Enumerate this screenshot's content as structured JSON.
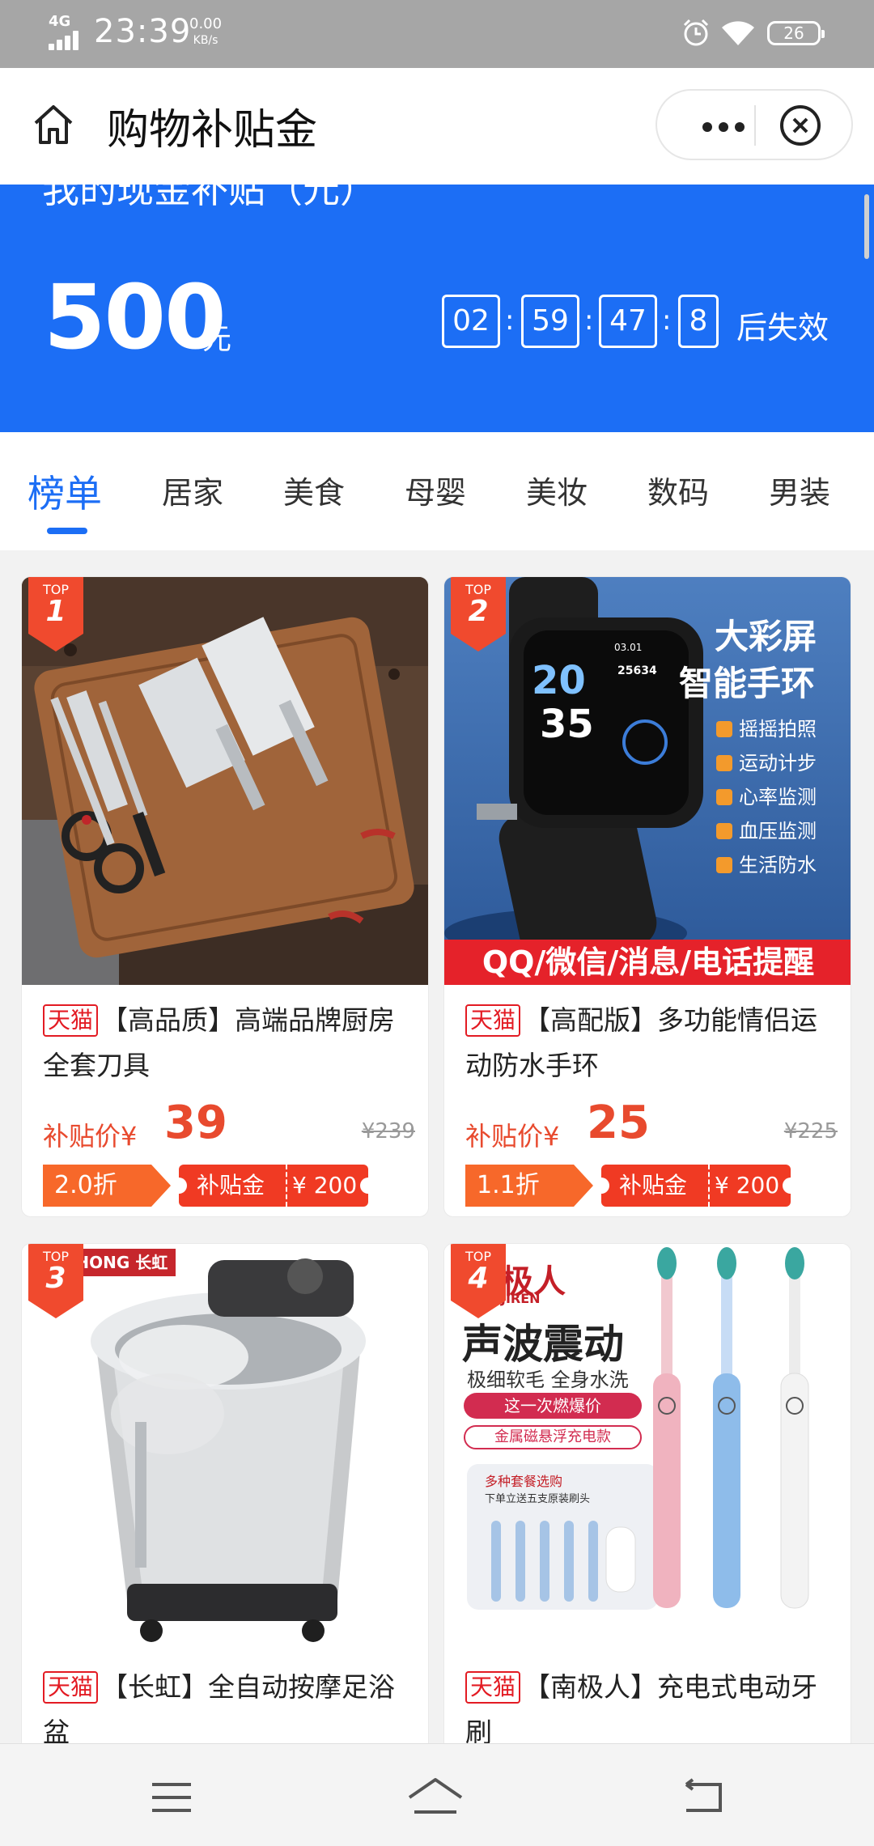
{
  "status_bar": {
    "network": "4G",
    "time": "23:39",
    "speed_value": "0.00",
    "speed_unit": "KB/s",
    "battery": "26"
  },
  "header": {
    "title": "购物补贴金"
  },
  "banner": {
    "cut_text": "我的现金补贴（元）",
    "amount": "500",
    "unit": "元",
    "countdown": [
      "02",
      "59",
      "47",
      "8"
    ],
    "separator": ":",
    "expire_text": "后失效"
  },
  "tabs": [
    "榜单",
    "居家",
    "美食",
    "母婴",
    "美妆",
    "数码",
    "男装"
  ],
  "products": [
    {
      "rank_label": "TOP",
      "rank": "1",
      "shop": "天猫",
      "name": "【高品质】高端品牌厨房全套刀具",
      "price_label": "补贴价¥",
      "price": "39",
      "original_price": "¥239",
      "discount": "2.0折",
      "coupon_label": "补贴金",
      "coupon_value": "¥ 200"
    },
    {
      "rank_label": "TOP",
      "rank": "2",
      "shop": "天猫",
      "name": "【高配版】多功能情侣运动防水手环",
      "price_label": "补贴价¥",
      "price": "25",
      "original_price": "¥225",
      "discount": "1.1折",
      "coupon_label": "补贴金",
      "coupon_value": "¥ 200",
      "image_text": {
        "headline1": "大彩屏",
        "headline2": "智能手环",
        "features": [
          "摇摇拍照",
          "运动计步",
          "心率监测",
          "血压监测",
          "生活防水"
        ],
        "bottom": "QQ/微信/消息/电话提醒",
        "watch_time_h": "20",
        "watch_time_m": "35",
        "watch_date": "03.01",
        "watch_steps": "25634"
      }
    },
    {
      "rank_label": "TOP",
      "rank": "3",
      "shop": "天猫",
      "name": "【长虹】全自动按摩足浴盆",
      "image_text": {
        "brand": "GHONG 长虹"
      }
    },
    {
      "rank_label": "TOP",
      "rank": "4",
      "shop": "天猫",
      "name": "【南极人】充电式电动牙刷",
      "image_text": {
        "brand": "极人",
        "brand_en": "JIREN",
        "headline": "声波震动",
        "sub": "极细软毛 全身水洗",
        "pill1": "这一次燃爆价",
        "pill2": "金属磁悬浮充电款",
        "combo": "多种套餐选购",
        "combo_sub": "下单立送五支原装刷头"
      }
    }
  ],
  "colors": {
    "brand_blue": "#1c6ef5",
    "price_red": "#e84a2e",
    "coupon_red": "#f03a23",
    "discount_orange": "#f7682a",
    "tmall_red": "#e31b23"
  }
}
